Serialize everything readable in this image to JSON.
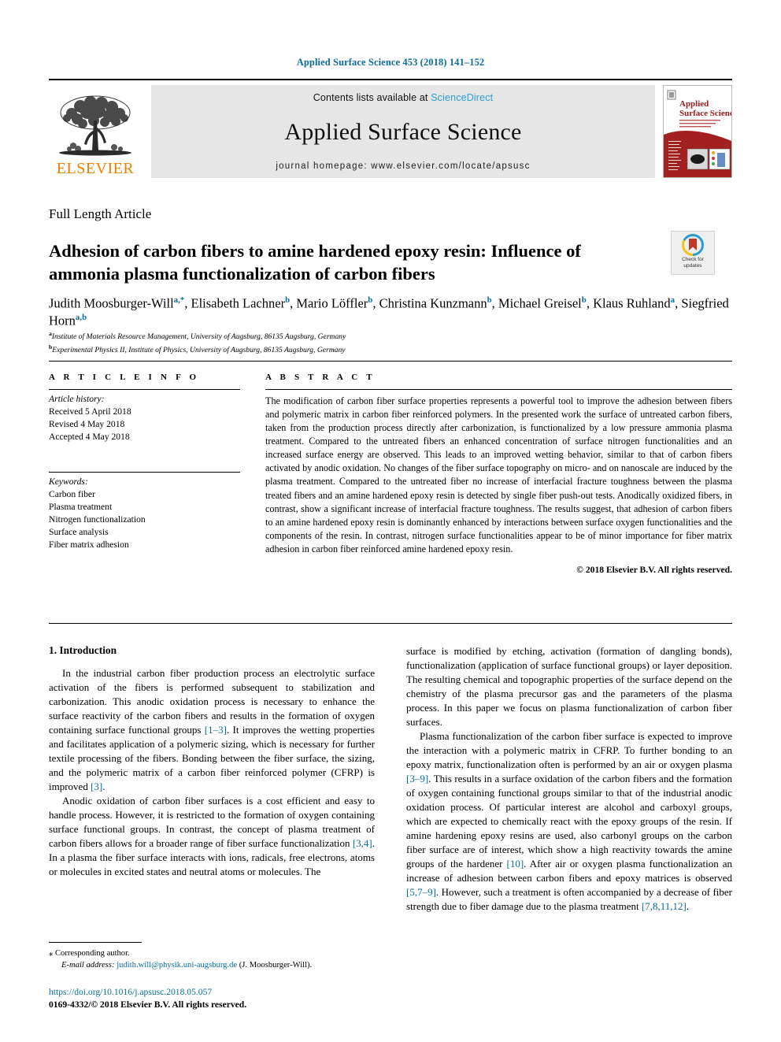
{
  "running_head": "Applied Surface Science 453 (2018) 141–152",
  "masthead": {
    "contents_prefix": "Contents lists available at ",
    "sciencedirect": "ScienceDirect",
    "journal_title": "Applied Surface Science",
    "homepage": "journal homepage: www.elsevier.com/locate/apsusc",
    "publisher_wordmark": "ELSEVIER",
    "publisher_logo_icon": "elsevier-tree-icon",
    "cover_title_line1": "Applied",
    "cover_title_line2": "Surface Science"
  },
  "article": {
    "type": "Full Length Article",
    "title": "Adhesion of carbon fibers to amine hardened epoxy resin: Influence of ammonia plasma functionalization of carbon fibers",
    "crossmark_label_line1": "Check for",
    "crossmark_label_line2": "updates",
    "crossmark_icon": "crossmark-badge-icon"
  },
  "authors": {
    "list": [
      {
        "name": "Judith Moosburger-Will",
        "sup": "a,*"
      },
      {
        "name": "Elisabeth Lachner",
        "sup": "b"
      },
      {
        "name": "Mario Löffler",
        "sup": "b"
      },
      {
        "name": "Christina Kunzmann",
        "sup": "b"
      },
      {
        "name": "Michael Greisel",
        "sup": "b"
      },
      {
        "name": "Klaus Ruhland",
        "sup": "a"
      },
      {
        "name": "Siegfried Horn",
        "sup": "a,b"
      }
    ],
    "affiliations": [
      {
        "marker": "a",
        "text": "Institute of Materials Resource Management, University of Augsburg, 86135 Augsburg, Germany"
      },
      {
        "marker": "b",
        "text": "Experimental Physics II, Institute of Physics, University of Augsburg, 86135 Augsburg, Germany"
      }
    ]
  },
  "article_info": {
    "heading": "A R T I C L E   I N F O",
    "history_label": "Article history:",
    "history": [
      "Received 5 April 2018",
      "Revised 4 May 2018",
      "Accepted 4 May 2018"
    ],
    "keywords_label": "Keywords:",
    "keywords": [
      "Carbon fiber",
      "Plasma treatment",
      "Nitrogen functionalization",
      "Surface analysis",
      "Fiber matrix adhesion"
    ]
  },
  "abstract": {
    "heading": "A B S T R A C T",
    "text": "The modification of carbon fiber surface properties represents a powerful tool to improve the adhesion between fibers and polymeric matrix in carbon fiber reinforced polymers. In the presented work the surface of untreated carbon fibers, taken from the production process directly after carbonization, is functionalized by a low pressure ammonia plasma treatment. Compared to the untreated fibers an enhanced concentration of surface nitrogen functionalities and an increased surface energy are observed. This leads to an improved wetting behavior, similar to that of carbon fibers activated by anodic oxidation. No changes of the fiber surface topography on micro- and on nanoscale are induced by the plasma treatment. Compared to the untreated fiber no increase of interfacial fracture toughness between the plasma treated fibers and an amine hardened epoxy resin is detected by single fiber push-out tests. Anodically oxidized fibers, in contrast, show a significant increase of interfacial fracture toughness. The results suggest, that adhesion of carbon fibers to an amine hardened epoxy resin is dominantly enhanced by interactions between surface oxygen functionalities and the components of the resin. In contrast, nitrogen surface functionalities appear to be of minor importance for fiber matrix adhesion in carbon fiber reinforced amine hardened epoxy resin.",
    "copyright": "© 2018 Elsevier B.V. All rights reserved."
  },
  "introduction": {
    "section_number_title": "1. Introduction",
    "left_paragraphs": [
      "In the industrial carbon fiber production process an electrolytic surface activation of the fibers is performed subsequent to stabilization and carbonization. This anodic oxidation process is necessary to enhance the surface reactivity of the carbon fibers and results in the formation of oxygen containing surface functional groups [1–3]. It improves the wetting properties and facilitates application of a polymeric sizing, which is necessary for further textile processing of the fibers. Bonding between the fiber surface, the sizing, and the polymeric matrix of a carbon fiber reinforced polymer (CFRP) is improved [3].",
      "Anodic oxidation of carbon fiber surfaces is a cost efficient and easy to handle process. However, it is restricted to the formation of oxygen containing surface functional groups. In contrast, the concept of plasma treatment of carbon fibers allows for a broader range of fiber surface functionalization [3,4]. In a plasma the fiber surface interacts with ions, radicals, free electrons, atoms or molecules in excited states and neutral atoms or molecules. The"
    ],
    "right_paragraphs": [
      "surface is modified by etching, activation (formation of dangling bonds), functionalization (application of surface functional groups) or layer deposition. The resulting chemical and topographic properties of the surface depend on the chemistry of the plasma precursor gas and the parameters of the plasma process. In this paper we focus on plasma functionalization of carbon fiber surfaces.",
      "Plasma functionalization of the carbon fiber surface is expected to improve the interaction with a polymeric matrix in CFRP. To further bonding to an epoxy matrix, functionalization often is performed by an air or oxygen plasma [3–9]. This results in a surface oxidation of the carbon fibers and the formation of oxygen containing functional groups similar to that of the industrial anodic oxidation process. Of particular interest are alcohol and carboxyl groups, which are expected to chemically react with the epoxy groups of the resin. If amine hardening epoxy resins are used, also carbonyl groups on the carbon fiber surface are of interest, which show a high reactivity towards the amine groups of the hardener [10]. After air or oxygen plasma functionalization an increase of adhesion between carbon fibers and epoxy matrices is observed [5,7–9]. However, such a treatment is often accompanied by a decrease of fiber strength due to fiber damage due to the plasma treatment [7,8,11,12]."
    ]
  },
  "footnote": {
    "star": "⁎",
    "corresponding": "Corresponding author.",
    "email_label": "E-mail address:",
    "email": "judith.will@physik.uni-augsburg.de",
    "email_owner": "(J. Moosburger-Will)."
  },
  "footer": {
    "doi": "https://doi.org/10.1016/j.apsusc.2018.05.057",
    "issn_line": "0169-4332/© 2018 Elsevier B.V. All rights reserved."
  },
  "colors": {
    "link_teal": "#0a6e9c",
    "sciencedirect_blue": "#2b9fd8",
    "elsevier_orange": "#ef7d00",
    "band_gray": "#e6e6e6"
  }
}
